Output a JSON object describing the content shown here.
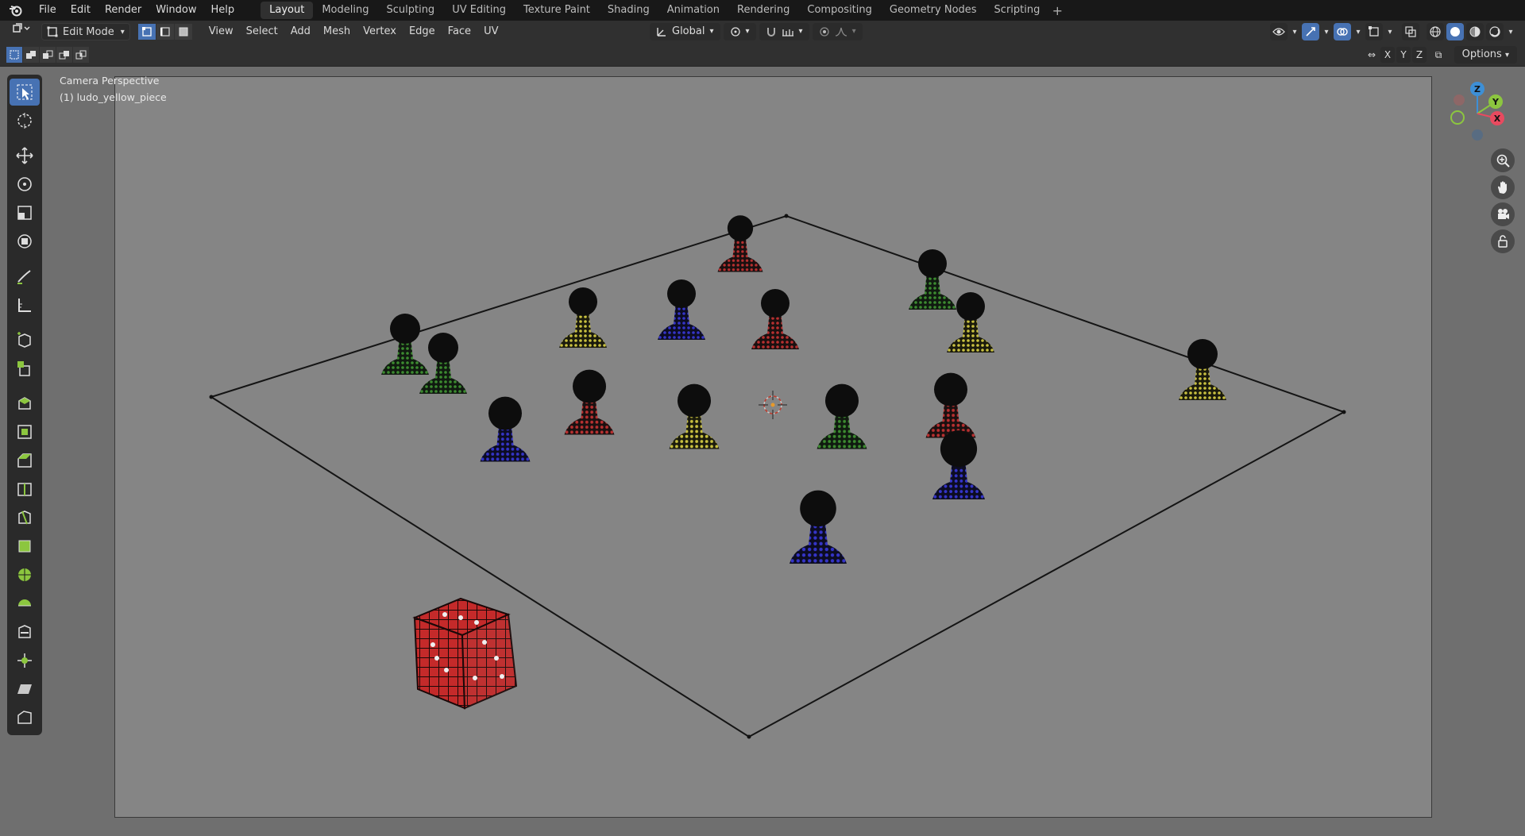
{
  "menubar": {
    "items": [
      "File",
      "Edit",
      "Render",
      "Window",
      "Help"
    ]
  },
  "workspaces": {
    "tabs": [
      "Layout",
      "Modeling",
      "Sculpting",
      "UV Editing",
      "Texture Paint",
      "Shading",
      "Animation",
      "Rendering",
      "Compositing",
      "Geometry Nodes",
      "Scripting"
    ],
    "active": "Layout"
  },
  "header": {
    "mode": "Edit Mode",
    "menus": [
      "View",
      "Select",
      "Add",
      "Mesh",
      "Vertex",
      "Edge",
      "Face",
      "UV"
    ],
    "orientation": "Global"
  },
  "header3": {
    "axes": [
      "X",
      "Y",
      "Z"
    ],
    "options_label": "Options"
  },
  "viewport": {
    "camera_label": "Camera Perspective",
    "object_label": "(1) ludo_yellow_piece"
  },
  "gizmo": {
    "axes": [
      "X",
      "Y",
      "Z"
    ]
  },
  "colors": {
    "accent": "#4772b3",
    "axis_x": "#e84a5f",
    "axis_y": "#8cc63f",
    "axis_z": "#3d8fd6"
  }
}
